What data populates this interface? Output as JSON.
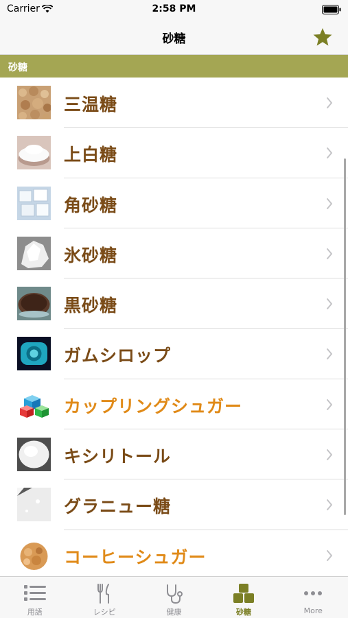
{
  "status": {
    "carrier": "Carrier",
    "time": "2:58 PM"
  },
  "nav": {
    "title": "砂糖",
    "star_icon": "star-icon",
    "accent": "#7b7f25"
  },
  "section": {
    "title": "砂糖",
    "color": "#a4a653"
  },
  "items": [
    {
      "label": "三温糖",
      "thumb": "brown-sugar-photo",
      "highlight": false
    },
    {
      "label": "上白糖",
      "thumb": "white-sugar-photo",
      "highlight": false
    },
    {
      "label": "角砂糖",
      "thumb": "sugar-cubes-photo",
      "highlight": false
    },
    {
      "label": "氷砂糖",
      "thumb": "rock-sugar-photo",
      "highlight": false
    },
    {
      "label": "黒砂糖",
      "thumb": "black-sugar-photo",
      "highlight": false
    },
    {
      "label": "ガムシロップ",
      "thumb": "gum-syrup-photo",
      "highlight": false
    },
    {
      "label": "カップリングシュガー",
      "thumb": "coupling-sugar-photo",
      "highlight": true
    },
    {
      "label": "キシリトール",
      "thumb": "xylitol-photo",
      "highlight": false
    },
    {
      "label": "グラニュー糖",
      "thumb": "granulated-sugar-photo",
      "highlight": false
    },
    {
      "label": "コーヒーシュガー",
      "thumb": "coffee-sugar-photo",
      "highlight": true
    }
  ],
  "tabs": [
    {
      "label": "用語",
      "icon": "list-icon",
      "active": false
    },
    {
      "label": "レシピ",
      "icon": "fork-knife-icon",
      "active": false
    },
    {
      "label": "健康",
      "icon": "stethoscope-icon",
      "active": false
    },
    {
      "label": "砂糖",
      "icon": "sugar-cubes-icon",
      "active": true
    },
    {
      "label": "More",
      "icon": "more-icon",
      "active": false
    }
  ],
  "colors": {
    "label": "#7a4b17",
    "label_highlight": "#e08a18",
    "tab_inactive": "#8e8e93"
  }
}
